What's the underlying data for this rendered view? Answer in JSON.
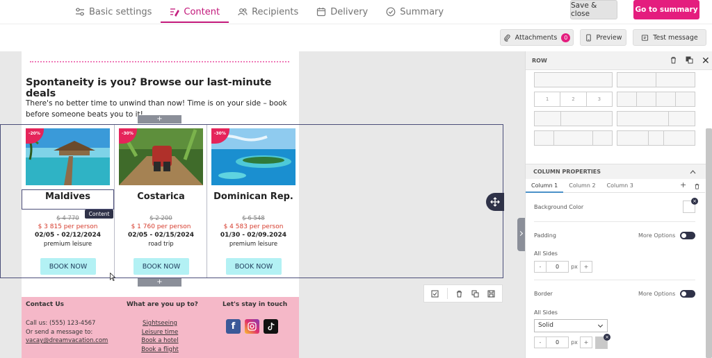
{
  "nav": {
    "steps": [
      {
        "label": "Basic settings",
        "icon": "sliders-icon"
      },
      {
        "label": "Content",
        "icon": "edit-icon",
        "active": true
      },
      {
        "label": "Recipients",
        "icon": "users-icon"
      },
      {
        "label": "Delivery",
        "icon": "calendar-icon"
      },
      {
        "label": "Summary",
        "icon": "check-circle-icon"
      }
    ],
    "save_close": "Save & close",
    "go_summary": "Go to summary"
  },
  "toolbar": {
    "attachments": "Attachments",
    "attachments_count": "0",
    "preview": "Preview",
    "test_message": "Test message"
  },
  "email": {
    "headline": "Spontaneity is you? Browse our last-minute deals",
    "intro": "There's no better time to unwind than now! Time is on your side – book before someone beats you to it!",
    "plus": "+",
    "deals": [
      {
        "discount": "-20%",
        "name": "Maldives",
        "old_price": "$ 4 770",
        "price": "$ 3 815 per person",
        "dates": "02/05 - 02/12/2024",
        "kind": "premium leisure",
        "cta": "BOOK NOW"
      },
      {
        "discount": "-30%",
        "name": "Costarica",
        "old_price": "$ 2 200",
        "price": "$ 1 760 per person",
        "dates": "02/05 - 02/15/2024",
        "kind": "road trip",
        "cta": "BOOK NOW"
      },
      {
        "discount": "-30%",
        "name": "Dominican Rep.",
        "old_price": "$ 6 548",
        "price": "$ 4 583 per person",
        "dates": "01/30 - 02/09.2024",
        "kind": "premium leisure",
        "cta": "BOOK NOW"
      }
    ],
    "tooltip": "Content",
    "footer": {
      "contact_title": "Contact Us",
      "contact_lines": [
        "Call us: (555) 123-4567",
        "Or send a message to:",
        "vacay@dreamvacation.com"
      ],
      "interests_title": "What are you up to?",
      "interests": [
        "Sightseeing",
        "Leisure time",
        "Book a hotel",
        "Book a flight"
      ],
      "social_title": "Let's stay in touch"
    }
  },
  "panel": {
    "row_title": "ROW",
    "layout_labels": [
      "1",
      "2",
      "3"
    ],
    "column_properties": "COLUMN PROPERTIES",
    "column_tabs": [
      "Column 1",
      "Column 2",
      "Column 3"
    ],
    "background_color": "Background Color",
    "padding": "Padding",
    "more_options": "More Options",
    "all_sides": "All Sides",
    "padding_value": "0",
    "unit": "px",
    "border": "Border",
    "border_style": "Solid",
    "border_value": "0",
    "minus": "-",
    "plus": "+"
  },
  "colors": {
    "accent": "#e41d7e",
    "active_step": "#c2177a",
    "footer_bg": "#f5b8c8",
    "book_btn": "#b3f1f4",
    "price_red": "#d63b2c",
    "selection": "#4a4d78"
  }
}
